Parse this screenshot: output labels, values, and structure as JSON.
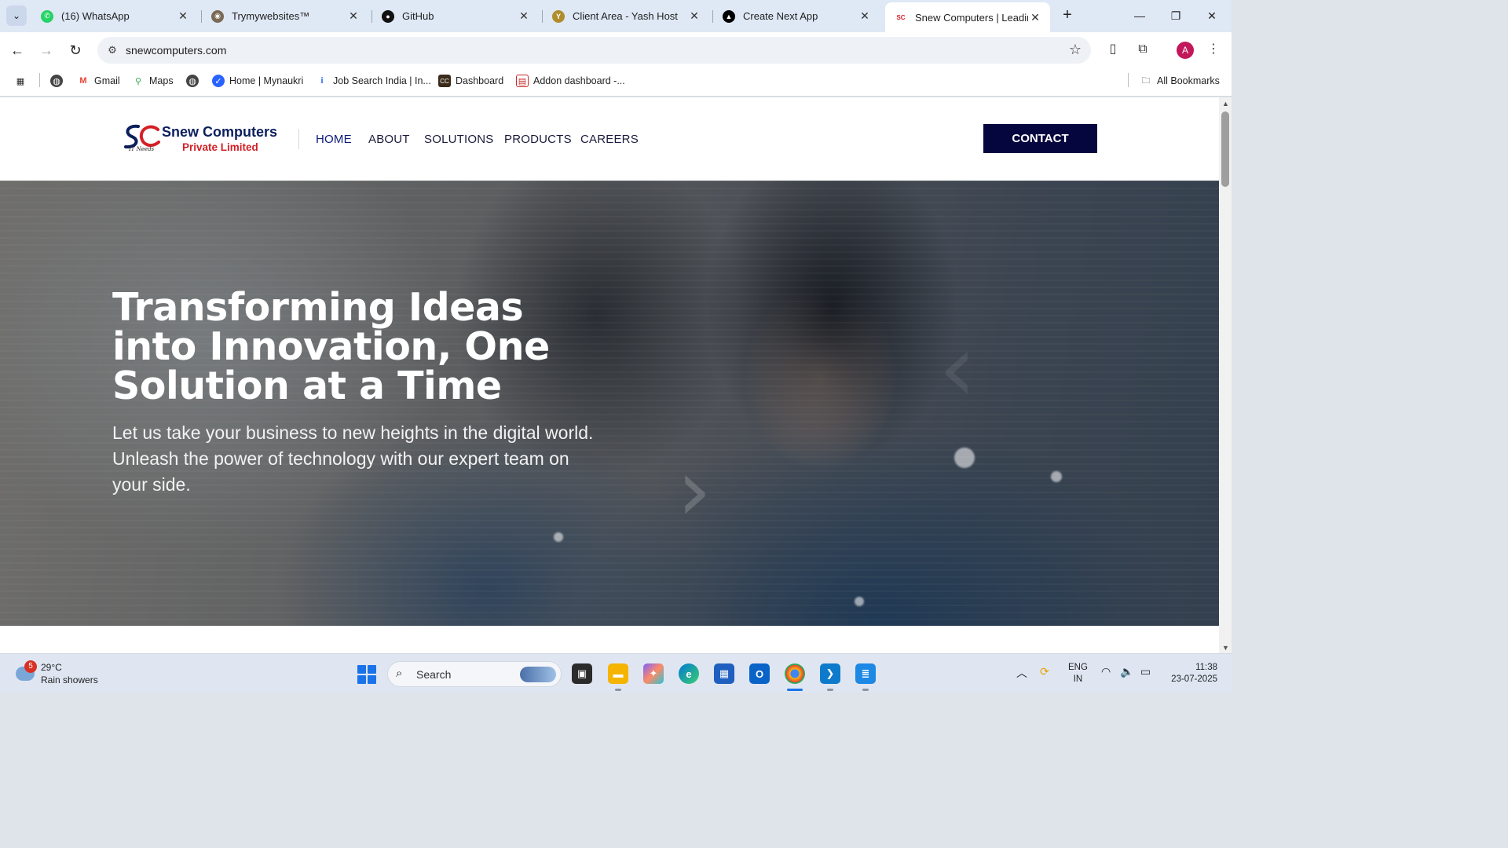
{
  "browser": {
    "tabs": [
      {
        "title": "(16) WhatsApp",
        "icon": "whatsapp-icon",
        "color": "#25d366"
      },
      {
        "title": "Trymywebsites™",
        "icon": "trymywebsites-icon",
        "color": "#7a6a55"
      },
      {
        "title": "GitHub",
        "icon": "github-icon",
        "color": "#111111"
      },
      {
        "title": "Client Area - Yash Host",
        "icon": "yash-host-icon",
        "color": "#b08d2c"
      },
      {
        "title": "Create Next App",
        "icon": "nextjs-icon",
        "color": "#000000"
      },
      {
        "title": "Snew Computers | Leading",
        "icon": "snew-favicon",
        "color": "#d32027",
        "active": true
      }
    ],
    "url": "snewcomputers.com",
    "profile_initial": "A",
    "bookmarks": [
      {
        "label": "",
        "icon": "globe-icon"
      },
      {
        "label": "Gmail",
        "icon": "gmail-icon"
      },
      {
        "label": "Maps",
        "icon": "maps-icon"
      },
      {
        "label": "",
        "icon": "globe-icon"
      },
      {
        "label": "Home | Mynaukri",
        "icon": "mynaukri-icon"
      },
      {
        "label": "Job Search India | In...",
        "icon": "indeed-icon"
      },
      {
        "label": "Dashboard",
        "icon": "cc-icon"
      },
      {
        "label": "Addon dashboard -...",
        "icon": "addon-icon"
      }
    ],
    "all_bookmarks_label": "All Bookmarks"
  },
  "site": {
    "logo": {
      "initials": "SC",
      "name": "Snew Computers",
      "subtitle": "Private Limited",
      "tagline": "IT Needs"
    },
    "nav": [
      {
        "label": "HOME",
        "active": true
      },
      {
        "label": "ABOUT"
      },
      {
        "label": "SOLUTIONS"
      },
      {
        "label": "PRODUCTS"
      },
      {
        "label": "CAREERS"
      }
    ],
    "contact_label": "CONTACT",
    "hero": {
      "title": "Transforming Ideas into Innovation, One Solution at a Time",
      "subtitle": "Let us take your business to new heights in the digital world. Unleash the power of technology with our expert team on your side."
    },
    "colors": {
      "brand_navy": "#06063f",
      "brand_red": "#d32027"
    }
  },
  "taskbar": {
    "weather": {
      "badge": "5",
      "temp": "29°C",
      "desc": "Rain showers"
    },
    "search_label": "Search",
    "language": {
      "line1": "ENG",
      "line2": "IN"
    },
    "time": "11:38",
    "date": "23-07-2025"
  }
}
